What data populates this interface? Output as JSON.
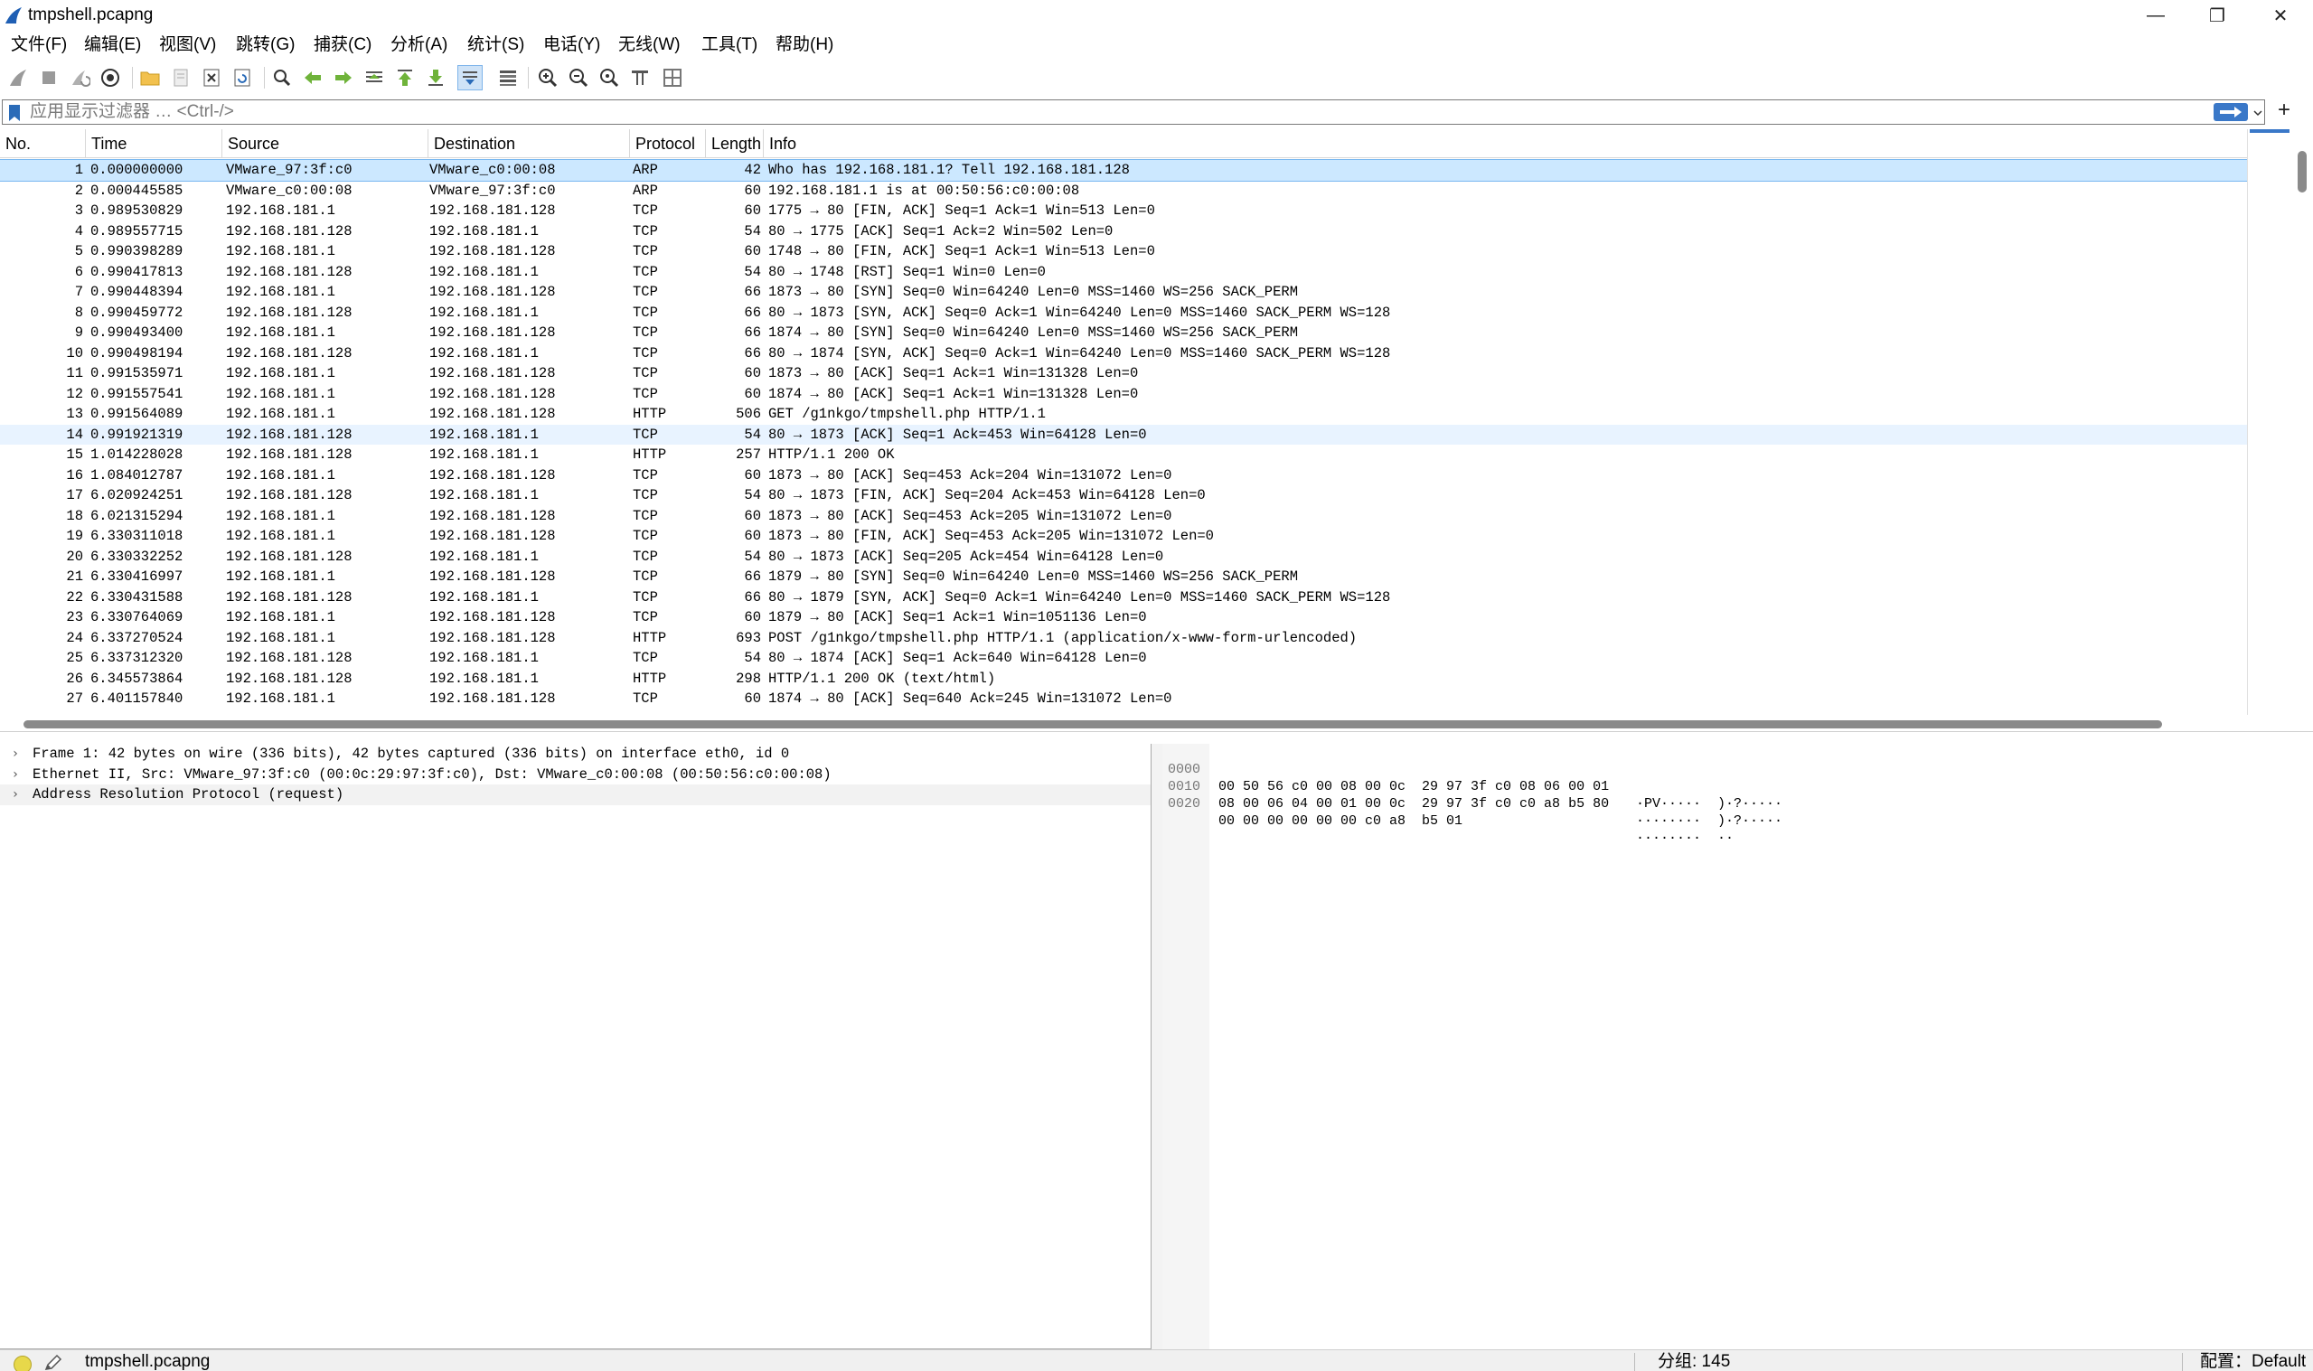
{
  "window": {
    "title": "tmpshell.pcapng",
    "controls": {
      "minimize": "—",
      "restore": "❐",
      "close": "✕"
    }
  },
  "menu": [
    "文件(F)",
    "编辑(E)",
    "视图(V)",
    "跳转(G)",
    "捕获(C)",
    "分析(A)",
    "统计(S)",
    "电话(Y)",
    "无线(W)",
    "工具(T)",
    "帮助(H)"
  ],
  "toolbar": {
    "icons": [
      "start-capture-icon",
      "stop-capture-icon",
      "restart-capture-icon",
      "capture-options-icon",
      "open-file-icon",
      "save-file-icon",
      "close-file-icon",
      "reload-file-icon",
      "find-packet-icon",
      "go-back-icon",
      "go-forward-icon",
      "go-to-packet-icon",
      "go-first-icon",
      "go-last-icon",
      "autoscroll-icon",
      "colorize-icon",
      "zoom-in-icon",
      "zoom-out-icon",
      "zoom-reset-icon",
      "resize-columns-icon",
      "layout-icon"
    ]
  },
  "filter": {
    "placeholder": "应用显示过滤器 … <Ctrl-/>",
    "add_label": "+"
  },
  "packet_list": {
    "columns": [
      "No.",
      "Time",
      "Source",
      "Destination",
      "Protocol",
      "Length",
      "Info"
    ],
    "selected_row": 1,
    "highlight_row": 14,
    "rows": [
      {
        "no": "1",
        "time": "0.000000000",
        "src": "VMware_97:3f:c0",
        "dst": "VMware_c0:00:08",
        "proto": "ARP",
        "len": "42",
        "info": "Who has 192.168.181.1? Tell 192.168.181.128"
      },
      {
        "no": "2",
        "time": "0.000445585",
        "src": "VMware_c0:00:08",
        "dst": "VMware_97:3f:c0",
        "proto": "ARP",
        "len": "60",
        "info": "192.168.181.1 is at 00:50:56:c0:00:08"
      },
      {
        "no": "3",
        "time": "0.989530829",
        "src": "192.168.181.1",
        "dst": "192.168.181.128",
        "proto": "TCP",
        "len": "60",
        "info": "1775 → 80 [FIN, ACK] Seq=1 Ack=1 Win=513 Len=0"
      },
      {
        "no": "4",
        "time": "0.989557715",
        "src": "192.168.181.128",
        "dst": "192.168.181.1",
        "proto": "TCP",
        "len": "54",
        "info": "80 → 1775 [ACK] Seq=1 Ack=2 Win=502 Len=0"
      },
      {
        "no": "5",
        "time": "0.990398289",
        "src": "192.168.181.1",
        "dst": "192.168.181.128",
        "proto": "TCP",
        "len": "60",
        "info": "1748 → 80 [FIN, ACK] Seq=1 Ack=1 Win=513 Len=0"
      },
      {
        "no": "6",
        "time": "0.990417813",
        "src": "192.168.181.128",
        "dst": "192.168.181.1",
        "proto": "TCP",
        "len": "54",
        "info": "80 → 1748 [RST] Seq=1 Win=0 Len=0"
      },
      {
        "no": "7",
        "time": "0.990448394",
        "src": "192.168.181.1",
        "dst": "192.168.181.128",
        "proto": "TCP",
        "len": "66",
        "info": "1873 → 80 [SYN] Seq=0 Win=64240 Len=0 MSS=1460 WS=256 SACK_PERM"
      },
      {
        "no": "8",
        "time": "0.990459772",
        "src": "192.168.181.128",
        "dst": "192.168.181.1",
        "proto": "TCP",
        "len": "66",
        "info": "80 → 1873 [SYN, ACK] Seq=0 Ack=1 Win=64240 Len=0 MSS=1460 SACK_PERM WS=128"
      },
      {
        "no": "9",
        "time": "0.990493400",
        "src": "192.168.181.1",
        "dst": "192.168.181.128",
        "proto": "TCP",
        "len": "66",
        "info": "1874 → 80 [SYN] Seq=0 Win=64240 Len=0 MSS=1460 WS=256 SACK_PERM"
      },
      {
        "no": "10",
        "time": "0.990498194",
        "src": "192.168.181.128",
        "dst": "192.168.181.1",
        "proto": "TCP",
        "len": "66",
        "info": "80 → 1874 [SYN, ACK] Seq=0 Ack=1 Win=64240 Len=0 MSS=1460 SACK_PERM WS=128"
      },
      {
        "no": "11",
        "time": "0.991535971",
        "src": "192.168.181.1",
        "dst": "192.168.181.128",
        "proto": "TCP",
        "len": "60",
        "info": "1873 → 80 [ACK] Seq=1 Ack=1 Win=131328 Len=0"
      },
      {
        "no": "12",
        "time": "0.991557541",
        "src": "192.168.181.1",
        "dst": "192.168.181.128",
        "proto": "TCP",
        "len": "60",
        "info": "1874 → 80 [ACK] Seq=1 Ack=1 Win=131328 Len=0"
      },
      {
        "no": "13",
        "time": "0.991564089",
        "src": "192.168.181.1",
        "dst": "192.168.181.128",
        "proto": "HTTP",
        "len": "506",
        "info": "GET /g1nkgo/tmpshell.php HTTP/1.1"
      },
      {
        "no": "14",
        "time": "0.991921319",
        "src": "192.168.181.128",
        "dst": "192.168.181.1",
        "proto": "TCP",
        "len": "54",
        "info": "80 → 1873 [ACK] Seq=1 Ack=453 Win=64128 Len=0"
      },
      {
        "no": "15",
        "time": "1.014228028",
        "src": "192.168.181.128",
        "dst": "192.168.181.1",
        "proto": "HTTP",
        "len": "257",
        "info": "HTTP/1.1 200 OK"
      },
      {
        "no": "16",
        "time": "1.084012787",
        "src": "192.168.181.1",
        "dst": "192.168.181.128",
        "proto": "TCP",
        "len": "60",
        "info": "1873 → 80 [ACK] Seq=453 Ack=204 Win=131072 Len=0"
      },
      {
        "no": "17",
        "time": "6.020924251",
        "src": "192.168.181.128",
        "dst": "192.168.181.1",
        "proto": "TCP",
        "len": "54",
        "info": "80 → 1873 [FIN, ACK] Seq=204 Ack=453 Win=64128 Len=0"
      },
      {
        "no": "18",
        "time": "6.021315294",
        "src": "192.168.181.1",
        "dst": "192.168.181.128",
        "proto": "TCP",
        "len": "60",
        "info": "1873 → 80 [ACK] Seq=453 Ack=205 Win=131072 Len=0"
      },
      {
        "no": "19",
        "time": "6.330311018",
        "src": "192.168.181.1",
        "dst": "192.168.181.128",
        "proto": "TCP",
        "len": "60",
        "info": "1873 → 80 [FIN, ACK] Seq=453 Ack=205 Win=131072 Len=0"
      },
      {
        "no": "20",
        "time": "6.330332252",
        "src": "192.168.181.128",
        "dst": "192.168.181.1",
        "proto": "TCP",
        "len": "54",
        "info": "80 → 1873 [ACK] Seq=205 Ack=454 Win=64128 Len=0"
      },
      {
        "no": "21",
        "time": "6.330416997",
        "src": "192.168.181.1",
        "dst": "192.168.181.128",
        "proto": "TCP",
        "len": "66",
        "info": "1879 → 80 [SYN] Seq=0 Win=64240 Len=0 MSS=1460 WS=256 SACK_PERM"
      },
      {
        "no": "22",
        "time": "6.330431588",
        "src": "192.168.181.128",
        "dst": "192.168.181.1",
        "proto": "TCP",
        "len": "66",
        "info": "80 → 1879 [SYN, ACK] Seq=0 Ack=1 Win=64240 Len=0 MSS=1460 SACK_PERM WS=128"
      },
      {
        "no": "23",
        "time": "6.330764069",
        "src": "192.168.181.1",
        "dst": "192.168.181.128",
        "proto": "TCP",
        "len": "60",
        "info": "1879 → 80 [ACK] Seq=1 Ack=1 Win=1051136 Len=0"
      },
      {
        "no": "24",
        "time": "6.337270524",
        "src": "192.168.181.1",
        "dst": "192.168.181.128",
        "proto": "HTTP",
        "len": "693",
        "info": "POST /g1nkgo/tmpshell.php HTTP/1.1  (application/x-www-form-urlencoded)"
      },
      {
        "no": "25",
        "time": "6.337312320",
        "src": "192.168.181.128",
        "dst": "192.168.181.1",
        "proto": "TCP",
        "len": "54",
        "info": "80 → 1874 [ACK] Seq=1 Ack=640 Win=64128 Len=0"
      },
      {
        "no": "26",
        "time": "6.345573864",
        "src": "192.168.181.128",
        "dst": "192.168.181.1",
        "proto": "HTTP",
        "len": "298",
        "info": "HTTP/1.1 200 OK  (text/html)"
      },
      {
        "no": "27",
        "time": "6.401157840",
        "src": "192.168.181.1",
        "dst": "192.168.181.128",
        "proto": "TCP",
        "len": "60",
        "info": "1874 → 80 [ACK] Seq=640 Ack=245 Win=131072 Len=0"
      }
    ]
  },
  "details": [
    "Frame 1: 42 bytes on wire (336 bits), 42 bytes captured (336 bits) on interface eth0, id 0",
    "Ethernet II, Src: VMware_97:3f:c0 (00:0c:29:97:3f:c0), Dst: VMware_c0:00:08 (00:50:56:c0:00:08)",
    "Address Resolution Protocol (request)"
  ],
  "bytes": [
    {
      "offset": "0000",
      "hex": "00 50 56 c0 00 08 00 0c  29 97 3f c0 08 06 00 01",
      "ascii": "·PV·····  )·?·····"
    },
    {
      "offset": "0010",
      "hex": "08 00 06 04 00 01 00 0c  29 97 3f c0 c0 a8 b5 80",
      "ascii": "········  )·?·····"
    },
    {
      "offset": "0020",
      "hex": "00 00 00 00 00 00 c0 a8  b5 01",
      "ascii": "········  ··"
    }
  ],
  "status": {
    "file": "tmpshell.pcapng",
    "packets": "分组: 145",
    "profile": "配置：Default"
  },
  "colors": {
    "selected_row": "#cce8ff",
    "highlight_row": "#e8f3ff",
    "accent": "#3a78c8"
  }
}
